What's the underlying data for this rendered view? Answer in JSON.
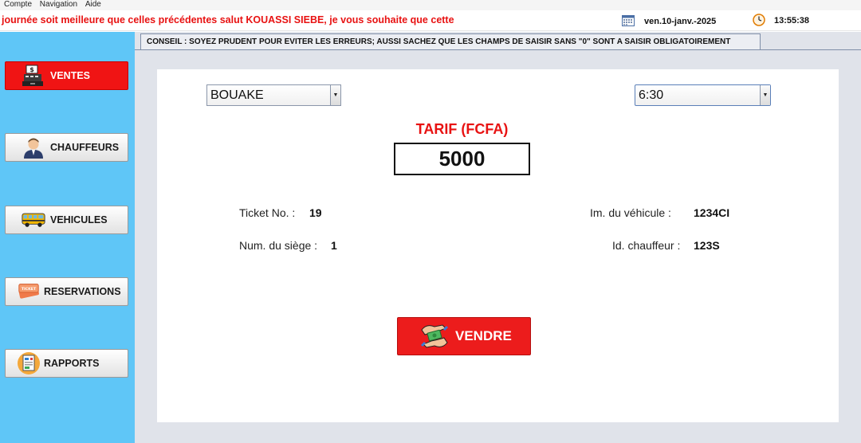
{
  "menubar": {
    "items": [
      "Compte",
      "Navigation",
      "Aide"
    ]
  },
  "ticker": {
    "text": "journée soit meilleure que celles précédentes  salut KOUASSI SIEBE, je vous souhaite que cette",
    "date": "ven.10-janv.-2025",
    "time": "13:55:38"
  },
  "sidebar": {
    "items": [
      {
        "label": "VENTES",
        "icon": "cash-register-icon",
        "active": true
      },
      {
        "label": "CHAUFFEURS",
        "icon": "driver-icon",
        "active": false
      },
      {
        "label": "VEHICULES",
        "icon": "bus-icon",
        "active": false
      },
      {
        "label": "RESERVATIONS",
        "icon": "ticket-icon",
        "active": false
      },
      {
        "label": "RAPPORTS",
        "icon": "report-icon",
        "active": false
      }
    ]
  },
  "tip": {
    "text": "CONSEIL : SOYEZ PRUDENT POUR EVITER LES ERREURS; AUSSI SACHEZ QUE LES CHAMPS DE SAISIR SANS \"0\"  SONT A SAISIR OBLIGATOIREMENT"
  },
  "form": {
    "destination": "BOUAKE",
    "departure_time": "6:30",
    "tarif_label": "TARIF (FCFA)",
    "tarif_value": "5000",
    "ticket_label": "Ticket No. :",
    "ticket_value": "19",
    "seat_label": "Num. du siège :",
    "seat_value": "1",
    "vehicle_label": "Im. du véhicule :",
    "vehicle_value": "1234CI",
    "driver_label": "Id. chauffeur :",
    "driver_value": "123S"
  },
  "actions": {
    "sell_label": "VENDRE"
  },
  "colors": {
    "accent_red": "#ec1c1c",
    "sidebar_blue": "#5fc6f7",
    "background_grey": "#e0e3ea"
  }
}
